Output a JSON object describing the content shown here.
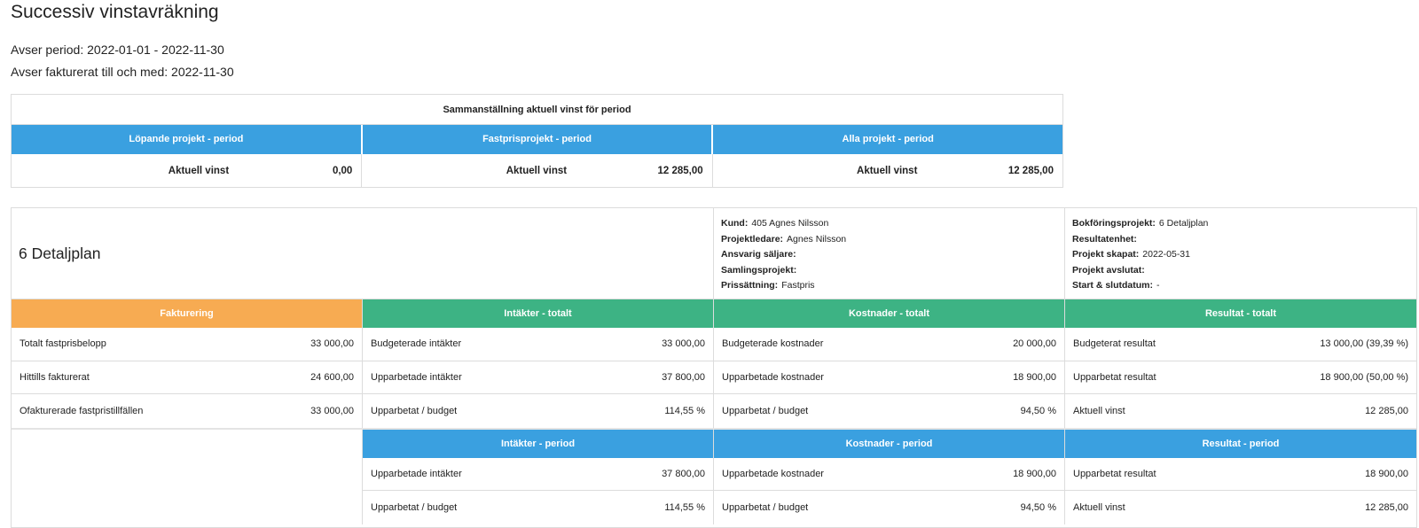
{
  "page": {
    "title": "Successiv vinstavräkning",
    "period": "Avser period: 2022-01-01 - 2022-11-30",
    "invoiced_until": "Avser fakturerat till och med: 2022-11-30"
  },
  "summary": {
    "title": "Sammanställning aktuell vinst för period",
    "columns": [
      {
        "header": "Löpande projekt - period",
        "label": "Aktuell vinst",
        "value": "0,00"
      },
      {
        "header": "Fastprisprojekt - period",
        "label": "Aktuell vinst",
        "value": "12 285,00"
      },
      {
        "header": "Alla projekt - period",
        "label": "Aktuell vinst",
        "value": "12 285,00"
      }
    ]
  },
  "project": {
    "name": "6 Detaljplan",
    "info_left": [
      {
        "key": "Kund:",
        "value": "405 Agnes Nilsson"
      },
      {
        "key": "Projektledare:",
        "value": "Agnes Nilsson"
      },
      {
        "key": "Ansvarig säljare:",
        "value": ""
      },
      {
        "key": "Samlingsprojekt:",
        "value": ""
      },
      {
        "key": "Prissättning:",
        "value": "Fastpris"
      }
    ],
    "info_right": [
      {
        "key": "Bokföringsprojekt:",
        "value": "6 Detaljplan"
      },
      {
        "key": "Resultatenhet:",
        "value": ""
      },
      {
        "key": "Projekt skapat:",
        "value": "2022-05-31"
      },
      {
        "key": "Projekt avslutat:",
        "value": ""
      },
      {
        "key": "Start & slutdatum:",
        "value": "-"
      }
    ],
    "total": {
      "fakturering": {
        "header": "Fakturering",
        "rows": [
          {
            "label": "Totalt fastprisbelopp",
            "value": "33 000,00"
          },
          {
            "label": "Hittills fakturerat",
            "value": "24 600,00"
          },
          {
            "label": "Ofakturerade fastpristillfällen",
            "value": "33 000,00"
          }
        ]
      },
      "intakter": {
        "header": "Intäkter - totalt",
        "rows": [
          {
            "label": "Budgeterade intäkter",
            "value": "33 000,00"
          },
          {
            "label": "Upparbetade intäkter",
            "value": "37 800,00"
          },
          {
            "label": "Upparbetat / budget",
            "value": "114,55 %"
          }
        ]
      },
      "kostnader": {
        "header": "Kostnader - totalt",
        "rows": [
          {
            "label": "Budgeterade kostnader",
            "value": "20 000,00"
          },
          {
            "label": "Upparbetade kostnader",
            "value": "18 900,00"
          },
          {
            "label": "Upparbetat / budget",
            "value": "94,50 %"
          }
        ]
      },
      "resultat": {
        "header": "Resultat - totalt",
        "rows": [
          {
            "label": "Budgeterat resultat",
            "value": "13 000,00  (39,39 %)"
          },
          {
            "label": "Upparbetat resultat",
            "value": "18 900,00  (50,00 %)"
          },
          {
            "label": "Aktuell vinst",
            "value": "12 285,00"
          }
        ]
      }
    },
    "period": {
      "intakter": {
        "header": "Intäkter - period",
        "rows": [
          {
            "label": "Upparbetade intäkter",
            "value": "37 800,00"
          },
          {
            "label": "Upparbetat / budget",
            "value": "114,55 %"
          }
        ]
      },
      "kostnader": {
        "header": "Kostnader - period",
        "rows": [
          {
            "label": "Upparbetade kostnader",
            "value": "18 900,00"
          },
          {
            "label": "Upparbetat / budget",
            "value": "94,50 %"
          }
        ]
      },
      "resultat": {
        "header": "Resultat - period",
        "rows": [
          {
            "label": "Upparbetat resultat",
            "value": "18 900,00"
          },
          {
            "label": "Aktuell vinst",
            "value": "12 285,00"
          }
        ]
      }
    }
  }
}
